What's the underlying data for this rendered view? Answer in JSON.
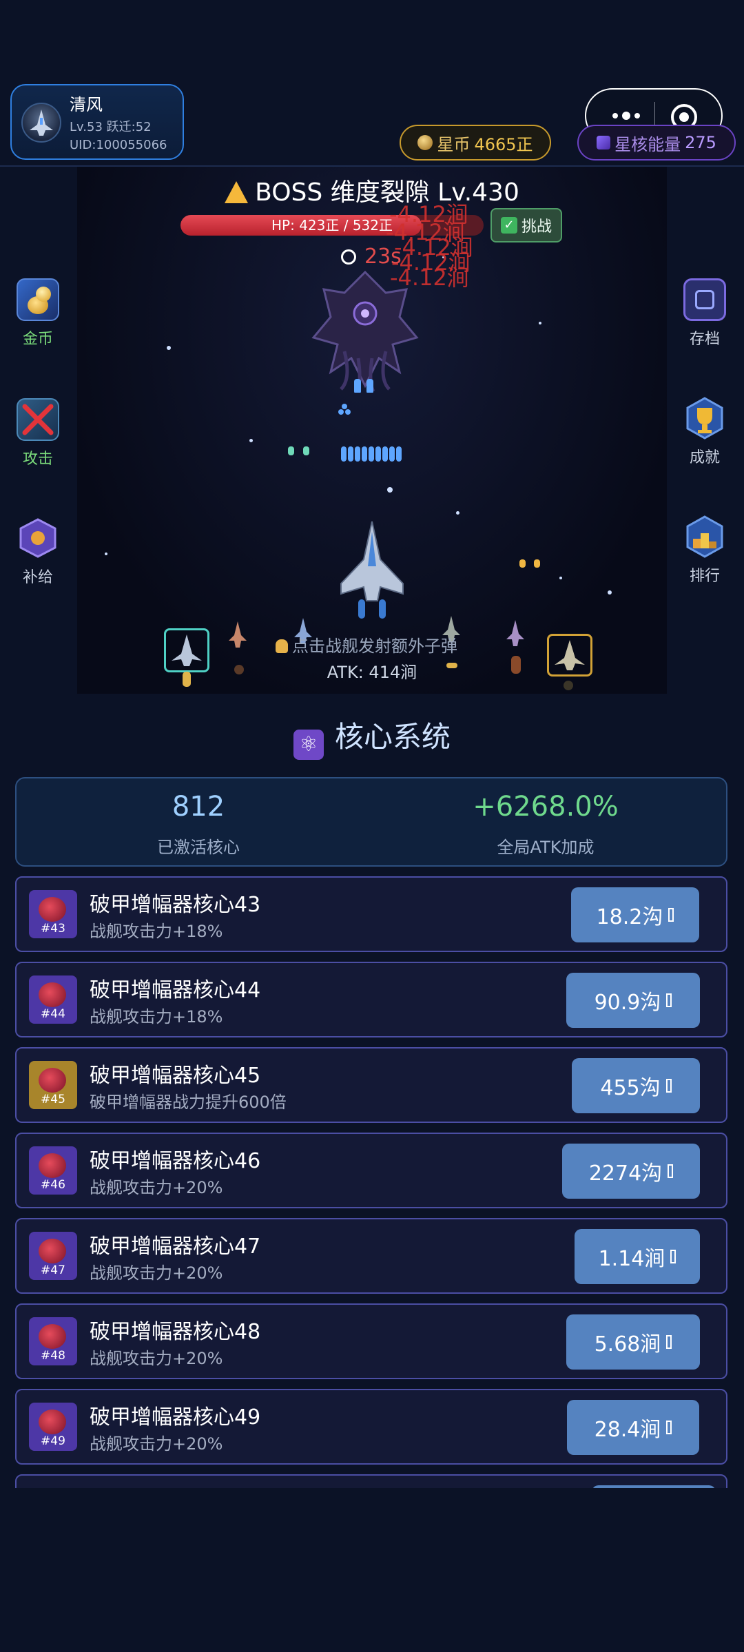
{
  "player": {
    "name": "清风",
    "level_text": "Lv.53 跃迁:52",
    "uid_text": "UID:100055066"
  },
  "currency": {
    "coin_label": "星币",
    "coin_value": "4665正",
    "energy_label": "星核能量",
    "energy_value": "275"
  },
  "boss": {
    "title": "BOSS 维度裂隙 Lv.430",
    "hp_text": "HP: 423正 / 532正",
    "hp_fraction": 0.795,
    "challenge_label": "挑战",
    "timer": "23s",
    "damage_texts": [
      "-4.12涧",
      "-4.12涧",
      "-4.12涧",
      "-4.12涧",
      "-4.12涧"
    ]
  },
  "battle": {
    "tap_hint": "点击战舰发射额外子弹",
    "atk_text": "ATK: 414涧"
  },
  "side_menu_left": [
    {
      "label": "金币",
      "color": "#7bdc7b",
      "icon": "gold-coins-icon"
    },
    {
      "label": "攻击",
      "color": "#7bdc7b",
      "icon": "crossed-swords-icon"
    },
    {
      "label": "补给",
      "color": "#c9d1e0",
      "icon": "supply-crate-icon"
    }
  ],
  "side_menu_right": [
    {
      "label": "存档",
      "color": "#c9d1e0",
      "icon": "save-icon"
    },
    {
      "label": "成就",
      "color": "#c9d1e0",
      "icon": "trophy-icon"
    },
    {
      "label": "排行",
      "color": "#c9d1e0",
      "icon": "podium-icon"
    }
  ],
  "core_system": {
    "title": "核心系统",
    "activated_value": "812",
    "activated_label": "已激活核心",
    "atk_bonus_value": "+6268.0%",
    "atk_bonus_label": "全局ATK加成",
    "items": [
      {
        "tag": "#43",
        "name": "破甲增幅器核心43",
        "desc": "战舰攻击力+18%",
        "price": "18.2沟",
        "gold": false
      },
      {
        "tag": "#44",
        "name": "破甲增幅器核心44",
        "desc": "战舰攻击力+18%",
        "price": "90.9沟",
        "gold": false
      },
      {
        "tag": "#45",
        "name": "破甲增幅器核心45",
        "desc": "破甲增幅器战力提升600倍",
        "price": "455沟",
        "gold": true
      },
      {
        "tag": "#46",
        "name": "破甲增幅器核心46",
        "desc": "战舰攻击力+20%",
        "price": "2274沟",
        "gold": false
      },
      {
        "tag": "#47",
        "name": "破甲增幅器核心47",
        "desc": "战舰攻击力+20%",
        "price": "1.14涧",
        "gold": false
      },
      {
        "tag": "#48",
        "name": "破甲增幅器核心48",
        "desc": "战舰攻击力+20%",
        "price": "5.68涧",
        "gold": false
      },
      {
        "tag": "#49",
        "name": "破甲增幅器核心49",
        "desc": "战舰攻击力+20%",
        "price": "28.4涧",
        "gold": false
      }
    ]
  },
  "colors": {
    "coin": "#f1c650",
    "energy": "#b99bff",
    "activated": "#9fd0ff",
    "atk_bonus": "#6fd98d",
    "card_border": "#4b4ea4",
    "buy_button": "#5583c0"
  }
}
